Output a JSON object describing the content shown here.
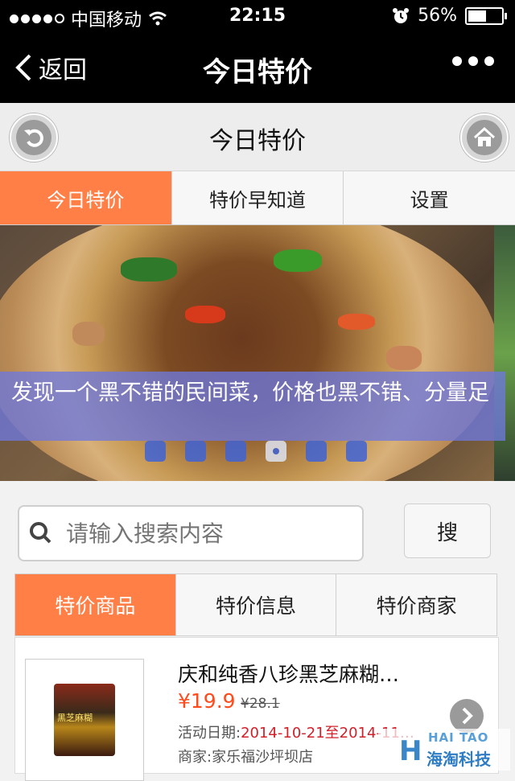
{
  "status_bar": {
    "carrier": "中国移动",
    "time": "22:15",
    "battery": "56%",
    "battery_level": 0.56
  },
  "navbar": {
    "back_label": "返回",
    "title": "今日特价"
  },
  "header": {
    "title": "今日特价"
  },
  "tabs": [
    {
      "label": "今日特价",
      "active": true
    },
    {
      "label": "特价早知道",
      "active": false
    },
    {
      "label": "设置",
      "active": false
    }
  ],
  "banner": {
    "caption": "发现一个黑不错的民间菜，价格也黑不错、分量足",
    "slide_count": 6,
    "active_slide": 4
  },
  "search": {
    "placeholder": "请输入搜索内容",
    "button_label": "搜"
  },
  "subtabs": [
    {
      "label": "特价商品",
      "active": true
    },
    {
      "label": "特价信息",
      "active": false
    },
    {
      "label": "特价商家",
      "active": false
    }
  ],
  "product": {
    "name": "庆和纯香八珍黑芝麻糊…",
    "price": "¥19.9",
    "old_price": "¥28.1",
    "date_label": "活动日期:",
    "date_value": "2014-10-21至2014-11…",
    "merchant": "商家:家乐福沙坪坝店",
    "package_text": "黑芝麻糊"
  },
  "watermark": {
    "line1": "HAI TAO",
    "line2": "海淘科技"
  },
  "colors": {
    "accent": "#ff7f47",
    "price": "#ff4a1a",
    "date": "#d0202a",
    "caption_bg": "#6e78dc"
  }
}
